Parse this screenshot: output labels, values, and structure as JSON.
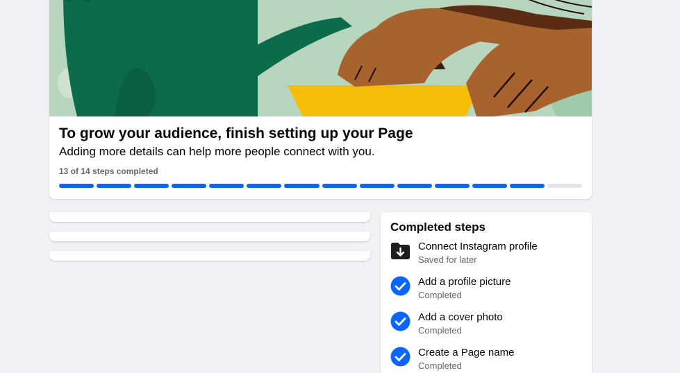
{
  "setup": {
    "title": "To grow your audience, finish setting up your Page",
    "subtitle": "Adding more details can help more people connect with you.",
    "steps_text": "13 of 14 steps completed",
    "progress": {
      "completed": 13,
      "total": 14
    }
  },
  "completed": {
    "title": "Completed steps",
    "items": [
      {
        "label": "Connect Instagram profile",
        "status": "Saved for later",
        "icon": "saved-folder-icon"
      },
      {
        "label": "Add a profile picture",
        "status": "Completed",
        "icon": "check-circle-icon"
      },
      {
        "label": "Add a cover photo",
        "status": "Completed",
        "icon": "check-circle-icon"
      },
      {
        "label": "Create a Page name",
        "status": "Completed",
        "icon": "check-circle-icon"
      }
    ]
  },
  "colors": {
    "progress_fill": "#0866ff",
    "progress_empty": "#e4e6eb",
    "check_blue": "#0866ff",
    "page_background": "#f0f2f5"
  }
}
